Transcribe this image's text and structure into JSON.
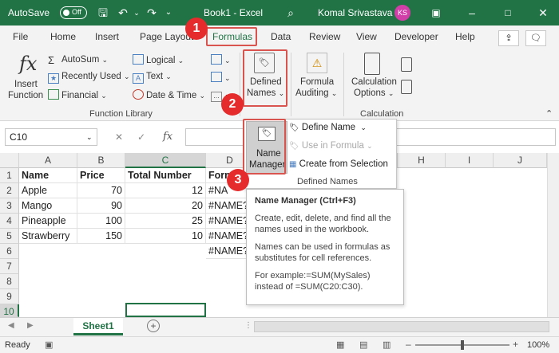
{
  "titlebar": {
    "autosave": "AutoSave",
    "toggle_state": "Off",
    "doc_title": "Book1 - Excel",
    "user_name": "Komal Srivastava",
    "avatar_initials": "KS",
    "brand_color": "#217346"
  },
  "tabs": [
    "File",
    "Home",
    "Insert",
    "Page Layout",
    "Formulas",
    "Data",
    "Review",
    "View",
    "Developer",
    "Help"
  ],
  "active_tab": "Formulas",
  "ribbon": {
    "insert_function": "Insert\nFunction",
    "insert_label": "Insert",
    "function_label": "Function",
    "autosum": "AutoSum",
    "recently_used": "Recently Used",
    "financial": "Financial",
    "logical": "Logical",
    "text": "Text",
    "date_time": "Date & Time",
    "group_function_library": "Function Library",
    "defined_names": "Defined",
    "defined_names2": "Names",
    "formula_auditing": "Formula",
    "formula_auditing2": "Auditing",
    "calculation_options": "Calculation",
    "calculation_options2": "Options",
    "group_calculation": "Calculation"
  },
  "formula_bar": {
    "name_box": "C10",
    "fx": "fx"
  },
  "columns": [
    "A",
    "B",
    "C",
    "D",
    "E",
    "F",
    "G",
    "H",
    "I",
    "J"
  ],
  "rows": [
    "1",
    "2",
    "3",
    "4",
    "5",
    "6",
    "7",
    "8",
    "9",
    "10"
  ],
  "table": {
    "headers": [
      "Name",
      "Price",
      "Total Number",
      "Form"
    ],
    "data": [
      [
        "Apple",
        "70",
        "12",
        "#NA"
      ],
      [
        "Mango",
        "90",
        "20",
        "#NAME?"
      ],
      [
        "Pineapple",
        "100",
        "25",
        "#NAME?"
      ],
      [
        "Strawberry",
        "150",
        "10",
        "#NAME?"
      ],
      [
        "",
        "",
        "",
        "#NAME?"
      ]
    ]
  },
  "dropdown": {
    "name_manager": "Name",
    "name_manager2": "Manager",
    "define_name": "Define Name",
    "use_in_formula": "Use in Formula",
    "create_from_selection": "Create from Selection",
    "group_label": "Defined Names"
  },
  "tooltip": {
    "title": "Name Manager (Ctrl+F3)",
    "p1": "Create, edit, delete, and find all the names used in the workbook.",
    "p2": "Names can be used in formulas as substitutes for cell references.",
    "p3": "For example:=SUM(MySales) instead of =SUM(C20:C30)."
  },
  "badges": [
    "1",
    "2",
    "3"
  ],
  "sheet_tab": "Sheet1",
  "status": {
    "ready": "Ready",
    "zoom": "100%"
  }
}
